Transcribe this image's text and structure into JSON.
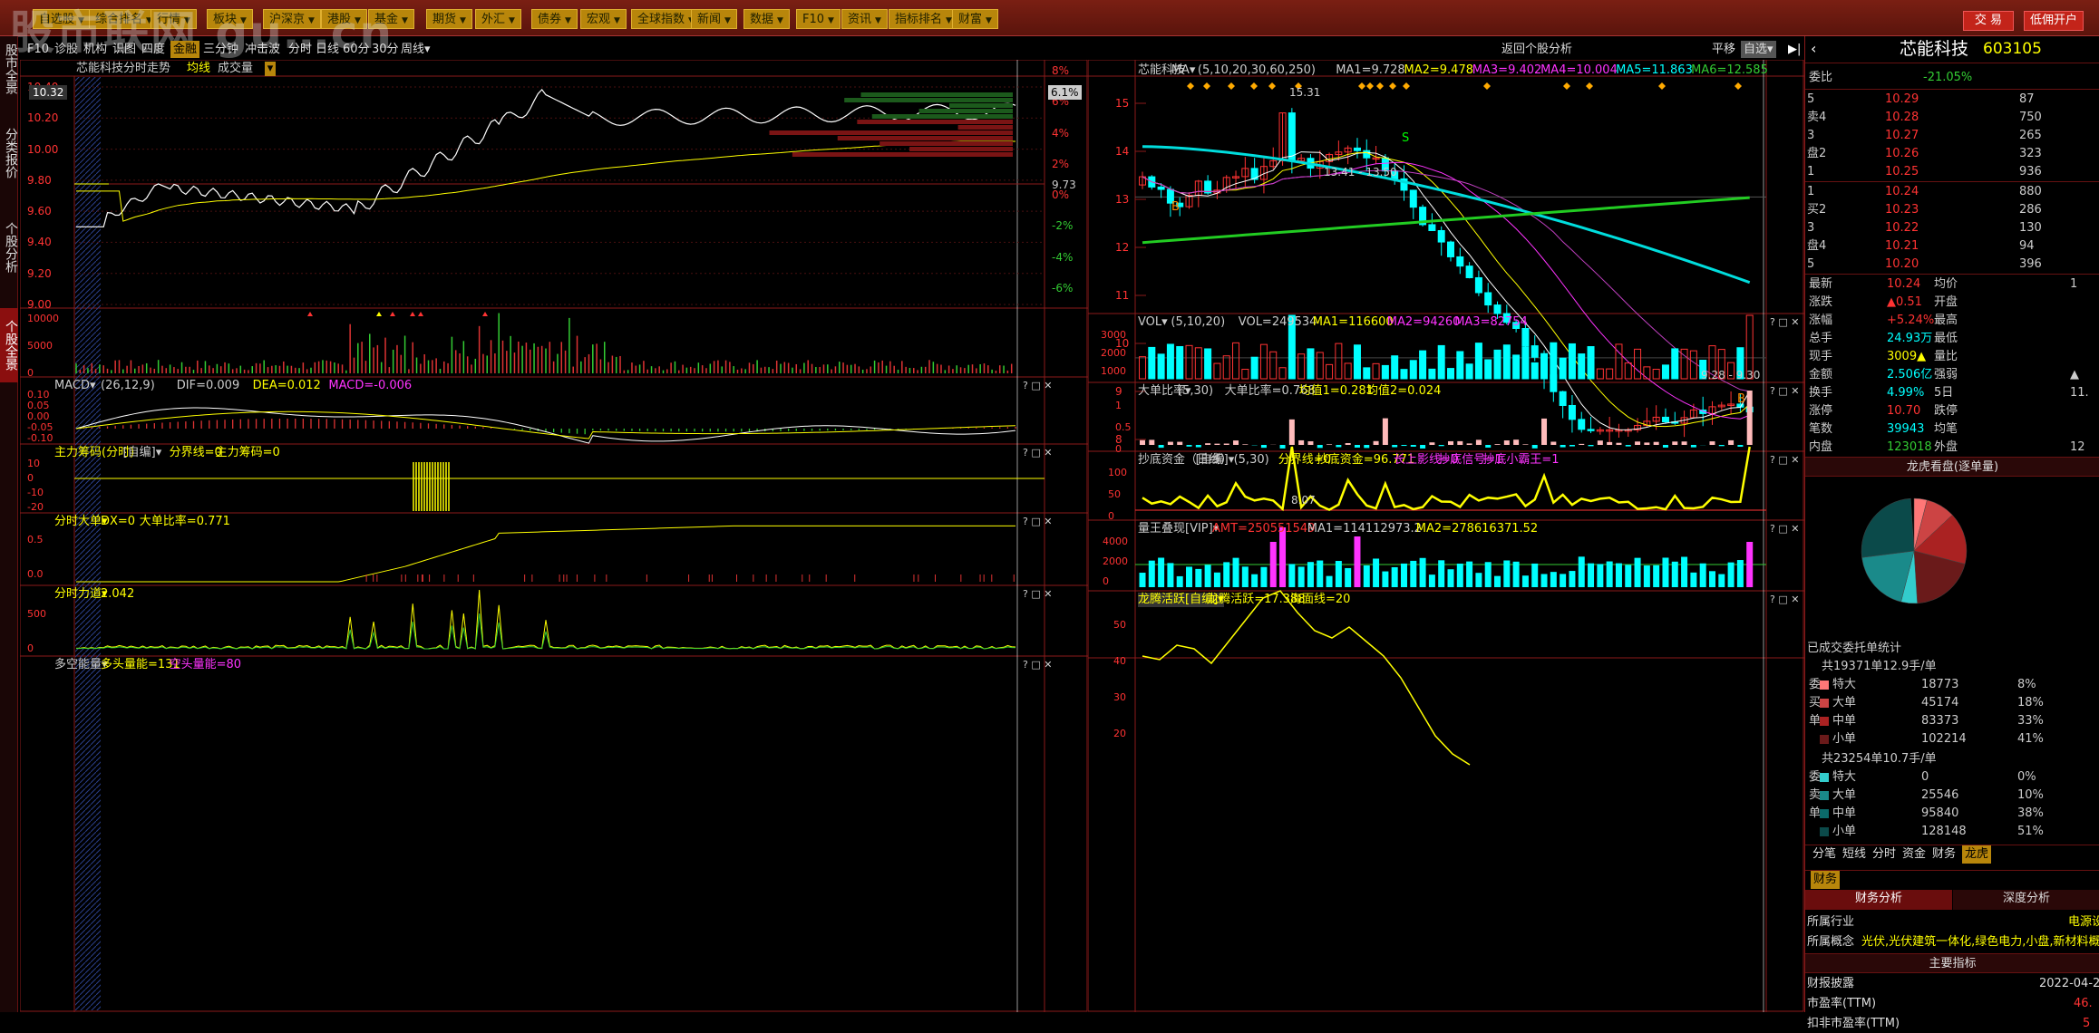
{
  "watermark": "股市联网 gu…cn",
  "menu": [
    "自选股",
    "综合排名",
    "行情",
    "板块",
    "沪深京",
    "港股",
    "基金",
    "期货",
    "外汇",
    "债券",
    "宏观",
    "全球指数",
    "新闻",
    "数据",
    "F10",
    "资讯",
    "指标排名",
    "财富"
  ],
  "top_right": {
    "trade": "交 易",
    "open_account": "低佣开户"
  },
  "left_tabs": [
    "股市全景",
    "分类报价",
    "个股分析",
    "个股全景"
  ],
  "left_tabs_active": 3,
  "toolbar": [
    "F10",
    "诊股",
    "机构",
    "识图",
    "四度",
    "金融",
    "三分钟",
    "冲击波",
    "分时",
    "日线",
    "60分",
    "30分",
    "周线▾"
  ],
  "toolbar_active": "金融",
  "right_toolbar": {
    "back": "返回个股分析",
    "flat": "平移",
    "watchlist": "自选▾"
  },
  "intraday": {
    "title": "芯能科技",
    "subtitle": "分时走势",
    "mid": "均线",
    "vol": "成交量",
    "yleft": [
      "10.40",
      "10.20",
      "10.00",
      "9.80",
      "9.60",
      "9.40",
      "9.20",
      "9.00"
    ],
    "current": "10.32",
    "yright": [
      "8%",
      "6%",
      "4%",
      "2%",
      "0%",
      "-2%",
      "-4%",
      "-6%"
    ],
    "last_change": "6.1%",
    "mid_price": "9.73",
    "vol_axis": [
      "10000",
      "5000",
      "0"
    ]
  },
  "macd": {
    "name": "MACD",
    "params": "(26,12,9)",
    "dif": "DIF=0.009",
    "dea": "DEA=0.012",
    "macd": "MACD=-0.006",
    "axis": [
      "0.10",
      "0.05",
      "0.00",
      "-0.05",
      "-0.10"
    ]
  },
  "chip": {
    "name": "主力筹码(分时)",
    "type": "[自编]",
    "line1": "分界线=0",
    "line2": "主力筹码=0",
    "axis": [
      "10",
      "0",
      "-10",
      "-20"
    ]
  },
  "bigorder": {
    "name": "分时大单",
    "dx": "DX=0",
    "ratio": "大单比率=0.771",
    "axis": [
      "0.5",
      "0.0"
    ]
  },
  "force": {
    "name": "分时力道",
    "val": "2.042",
    "axis": [
      "500",
      "0"
    ]
  },
  "multi": {
    "name": "多空能量",
    "long": "多头量能=131",
    "short": "空头量能=80"
  },
  "kline": {
    "title": "芯能科技",
    "ma": "MA▾",
    "params": "(5,10,20,30,60,250)",
    "ma1": "MA1=9.728",
    "ma2": "MA2=9.478",
    "ma3": "MA3=9.402",
    "ma4": "MA4=10.004",
    "ma5": "MA5=11.863",
    "ma6": "MA6=12.585",
    "axis": [
      "15",
      "14",
      "13",
      "12",
      "11",
      "10",
      "9",
      "8"
    ],
    "high": "15.31",
    "low": "8.07",
    "mid_label": "13.41 - 13.50",
    "range_label": "9.28 - 9.30"
  },
  "vol": {
    "name": "VOL",
    "params": "(5,10,20)",
    "v": "VOL=249534",
    "ma1": "MA1=116600",
    "ma2": "MA2=94260",
    "ma3": "MA3=82754",
    "axis": [
      "3000",
      "2000",
      "1000"
    ]
  },
  "bigratio": {
    "name": "大单比率",
    "params": "(5,30)",
    "r": "大单比率=0.768",
    "ma1": "均值1=0.281",
    "ma2": "均值2=0.024",
    "axis": [
      "1",
      "0.5",
      "0"
    ]
  },
  "bottom": {
    "name": "抄底资金（日线）",
    "type": "[自编]",
    "params": "(5,30)",
    "line": "分界线=0",
    "fund": "抄底资金=96.771",
    "sig1": "长上影线=0",
    "sig2": "抄底信号=1",
    "sig3": "抄底小霸王=1",
    "axis": [
      "100",
      "50",
      "0"
    ]
  },
  "kingvol": {
    "name": "量王叠现[VIP]",
    "amt": "AMT=250551549",
    "ma1": "MA1=114112973.2",
    "ma2": "MA2=278616371.52",
    "axis": [
      "4000",
      "2000",
      "0"
    ]
  },
  "dragon": {
    "name": "龙腾活跃[自编]",
    "val": "龙腾活跃=17.388",
    "line": "海面线=20",
    "axis": [
      "50",
      "40",
      "30",
      "20"
    ]
  },
  "quote": {
    "name": "芯能科技",
    "code": "603105",
    "webi_label": "委比",
    "webi": "-21.05%",
    "sell": [
      {
        "l": "5",
        "p": "10.29",
        "v": "87"
      },
      {
        "l": "卖4",
        "p": "10.28",
        "v": "750"
      },
      {
        "l": "3",
        "p": "10.27",
        "v": "265"
      },
      {
        "l": "盘2",
        "p": "10.26",
        "v": "323"
      },
      {
        "l": "1",
        "p": "10.25",
        "v": "936"
      }
    ],
    "buy": [
      {
        "l": "1",
        "p": "10.24",
        "v": "880"
      },
      {
        "l": "买2",
        "p": "10.23",
        "v": "286"
      },
      {
        "l": "3",
        "p": "10.22",
        "v": "130"
      },
      {
        "l": "盘4",
        "p": "10.21",
        "v": "94"
      },
      {
        "l": "5",
        "p": "10.20",
        "v": "396"
      }
    ],
    "stats": [
      [
        "最新",
        "10.24",
        "均价",
        "1"
      ],
      [
        "涨跌",
        "▲0.51",
        "开盘",
        ""
      ],
      [
        "涨幅",
        "+5.24%",
        "最高",
        ""
      ],
      [
        "总手",
        "24.93万",
        "最低",
        ""
      ],
      [
        "现手",
        "3009▲",
        "量比",
        ""
      ],
      [
        "金额",
        "2.506亿",
        "强弱",
        "▲"
      ],
      [
        "换手",
        "4.99%",
        "5日",
        "11."
      ],
      [
        "涨停",
        "10.70",
        "跌停",
        ""
      ],
      [
        "笔数",
        "39943",
        "均笔",
        ""
      ],
      [
        "内盘",
        "123018",
        "外盘",
        "12"
      ]
    ],
    "dragon_title": "龙虎看盘(逐单量)",
    "done_title": "已成交委托单统计",
    "buy_total": "共19371单12.9手/单",
    "buy_rows": [
      [
        "特大",
        "18773",
        "8%"
      ],
      [
        "大单",
        "45174",
        "18%"
      ],
      [
        "中单",
        "83373",
        "33%"
      ],
      [
        "小单",
        "102214",
        "41%"
      ]
    ],
    "buy_side": [
      "委",
      "买",
      "单",
      ""
    ],
    "sell_total": "共23254单10.7手/单",
    "sell_rows": [
      [
        "特大",
        "0",
        "0%"
      ],
      [
        "大单",
        "25546",
        "10%"
      ],
      [
        "中单",
        "95840",
        "38%"
      ],
      [
        "小单",
        "128148",
        "51%"
      ]
    ],
    "sell_side": [
      "委",
      "卖",
      "单",
      ""
    ],
    "tabs": [
      "分笔",
      "短线",
      "分时",
      "资金",
      "财务",
      "龙虎"
    ],
    "tabs_active": "龙虎",
    "fin_tab": "财务",
    "fin_sub": [
      "财务分析",
      "深度分析"
    ],
    "industry_label": "所属行业",
    "industry": "电源设",
    "concept_label": "所属概念",
    "concept": "光伏,光伏建筑一体化,绿色电力,小盘,新材料概",
    "main_ind": "主要指标",
    "report_label": "财报披露",
    "report": "2022-04-2",
    "pe_label": "市盈率(TTM)",
    "pe": "46.",
    "pe2_label": "扣非市盈率(TTM)",
    "pe2": "5"
  }
}
